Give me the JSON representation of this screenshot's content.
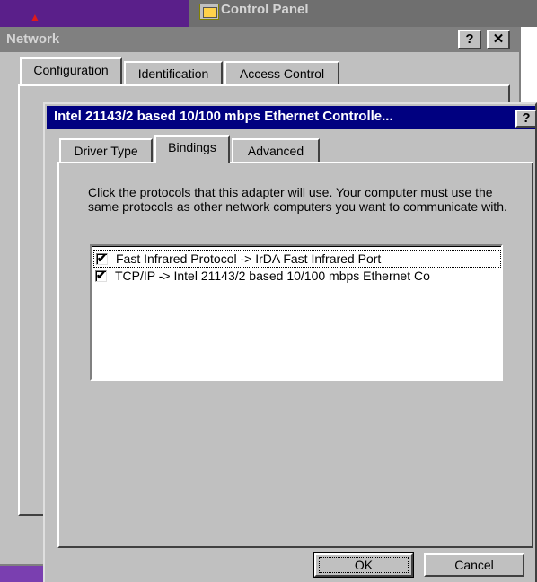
{
  "background": {
    "control_panel_title": "Control Panel"
  },
  "network_window": {
    "title": "Network",
    "help_button": "?",
    "close_button": "✕",
    "tabs": [
      {
        "label": "Configuration",
        "selected": true
      },
      {
        "label": "Identification",
        "selected": false
      },
      {
        "label": "Access Control",
        "selected": false
      }
    ]
  },
  "adapter_dialog": {
    "title": "Intel 21143/2 based 10/100 mbps Ethernet Controlle...",
    "help_button": "?",
    "close_button": "✕",
    "tabs": [
      {
        "label": "Driver Type",
        "selected": false
      },
      {
        "label": "Bindings",
        "selected": true
      },
      {
        "label": "Advanced",
        "selected": false
      }
    ],
    "description": "Click the protocols that this adapter will use. Your computer must use the same protocols as other network computers you want to communicate with.",
    "bindings": [
      {
        "label": "Fast Infrared Protocol -> IrDA Fast Infrared Port",
        "checked": true
      },
      {
        "label": "TCP/IP -> Intel 21143/2 based 10/100 mbps Ethernet Co",
        "checked": true
      }
    ],
    "check_mark": "✔",
    "ok_label": "OK",
    "cancel_label": "Cancel"
  },
  "colors": {
    "titlebar_active": "#000080",
    "titlebar_inactive": "#808080",
    "dialog_face": "#c0c0c0",
    "desktop_purple": "#5a1f8a"
  }
}
